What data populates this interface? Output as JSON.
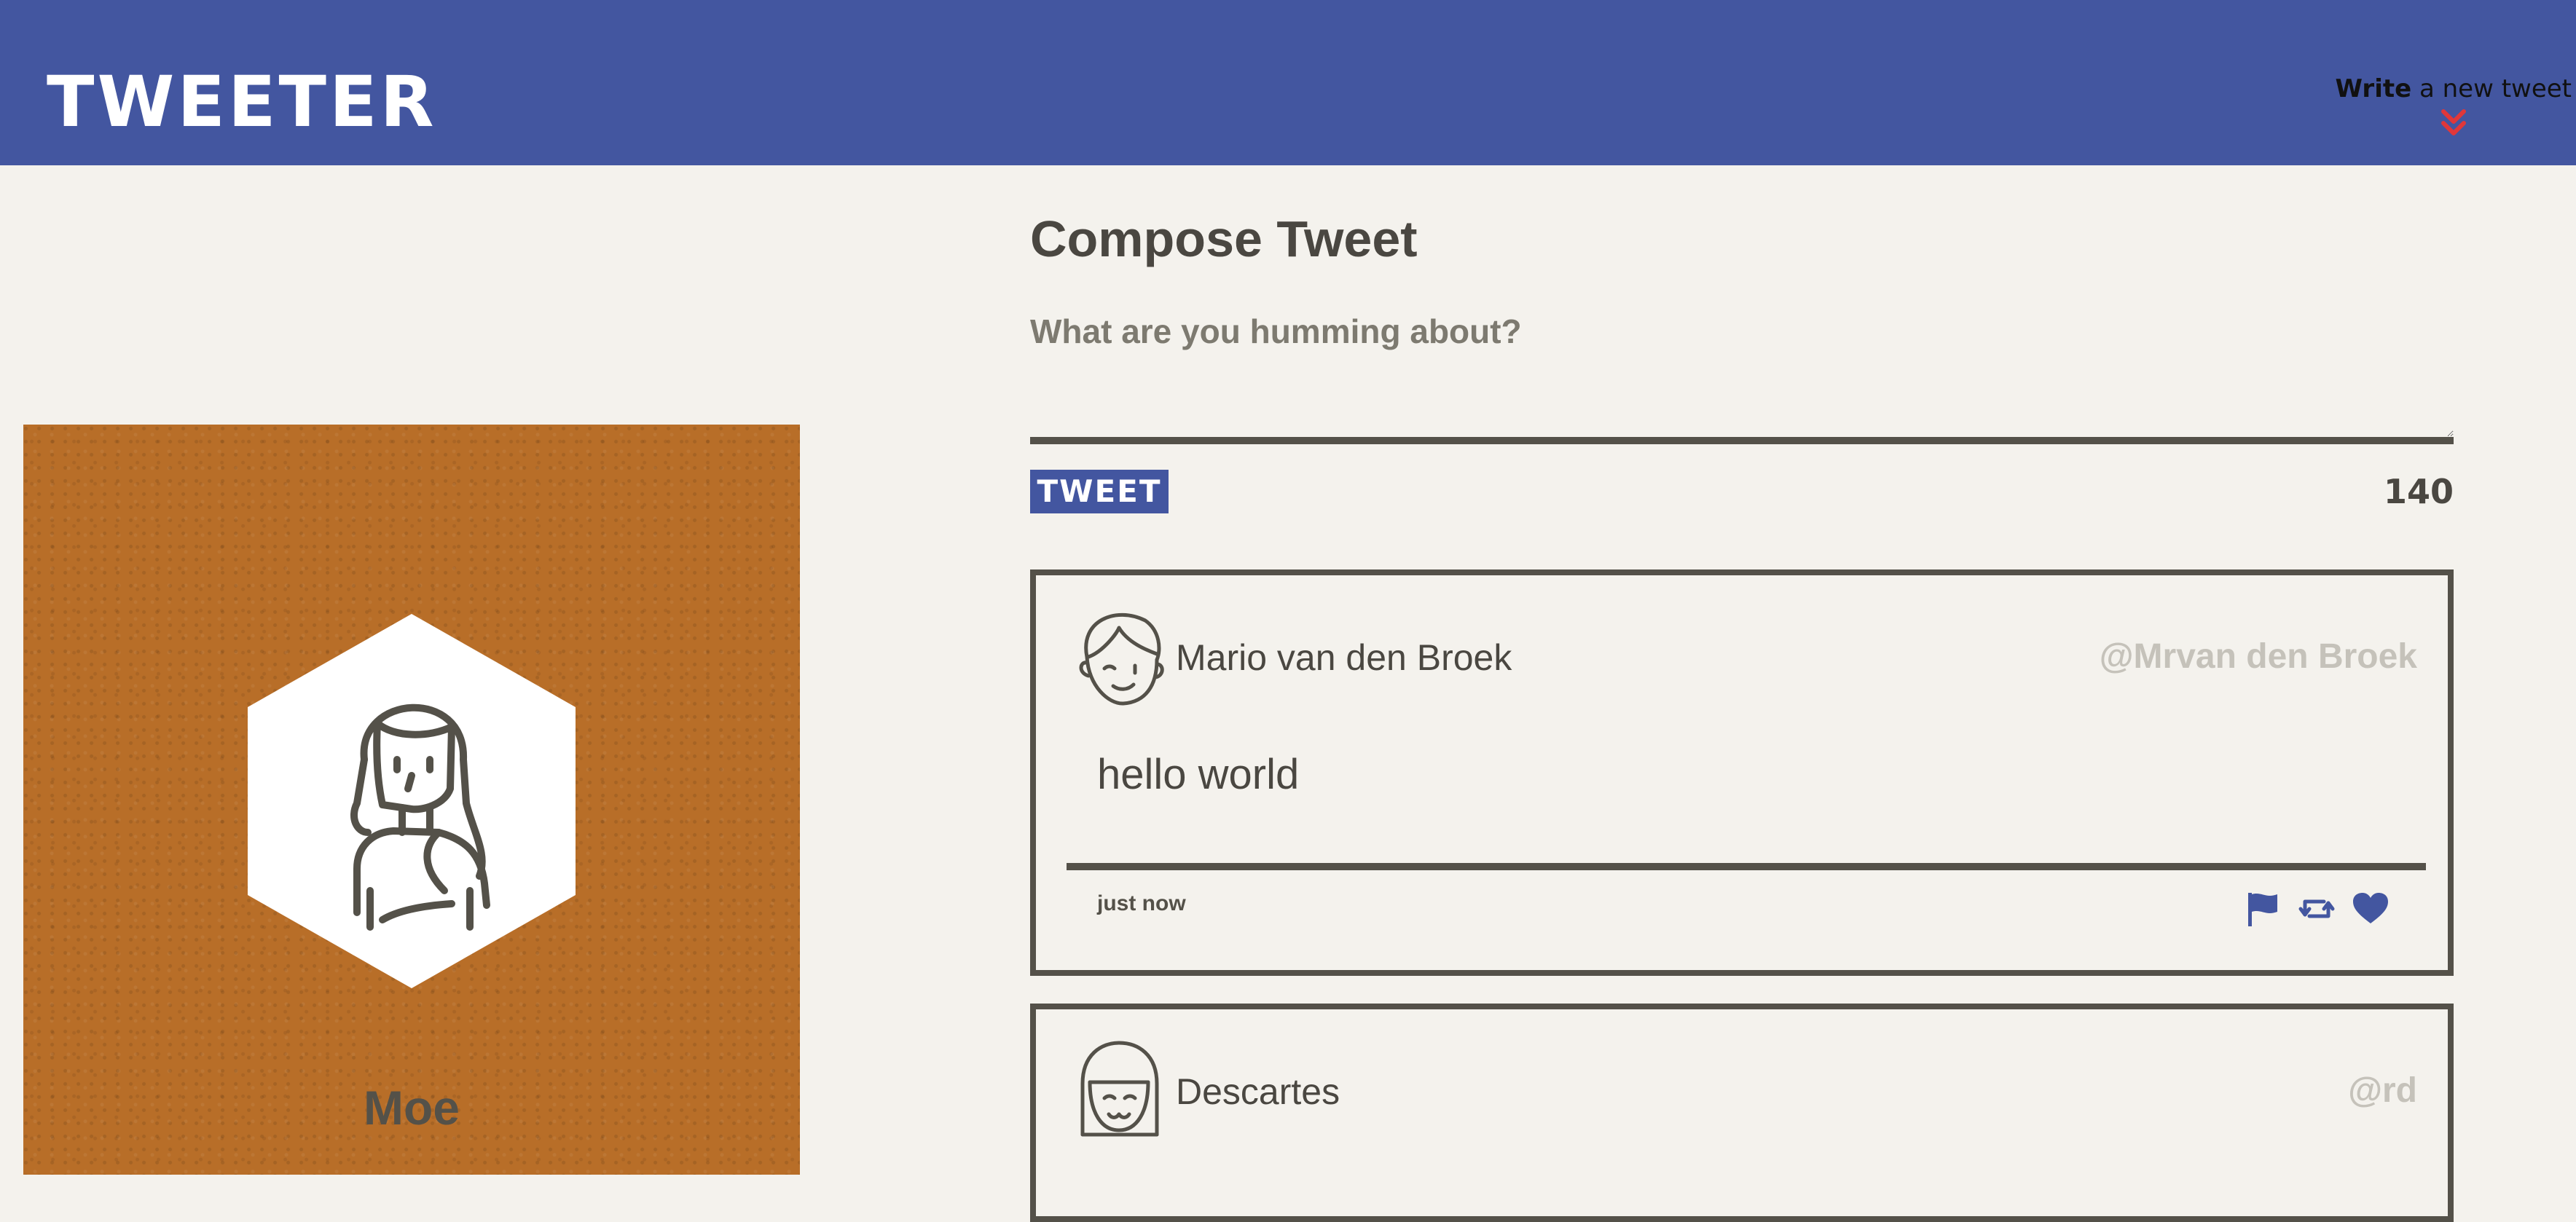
{
  "nav": {
    "brand": "TWEETER",
    "write_strong": "Write",
    "write_rest": " a new tweet",
    "chevron_icon": "double-chevron-down-icon",
    "chevron_color": "#e0373a"
  },
  "colors": {
    "accent": "#4356a0",
    "background": "#f4f2ed",
    "text": "#545149",
    "profile_bg": "#b86e28"
  },
  "profile": {
    "name": "Moe",
    "avatar_icon": "woman-avatar-icon"
  },
  "compose": {
    "title": "Compose Tweet",
    "placeholder": "What are you humming about?",
    "button_label": "TWEET",
    "counter": "140"
  },
  "tweets": [
    {
      "name": "Mario van den Broek",
      "handle": "@Mrvan den Broek",
      "text": "hello world",
      "time": "just now",
      "avatar_icon": "man-avatar-icon",
      "actions": [
        "flag-icon",
        "retweet-icon",
        "heart-icon"
      ]
    },
    {
      "name": "Descartes",
      "handle": "@rd",
      "avatar_icon": "girl-avatar-icon"
    }
  ]
}
